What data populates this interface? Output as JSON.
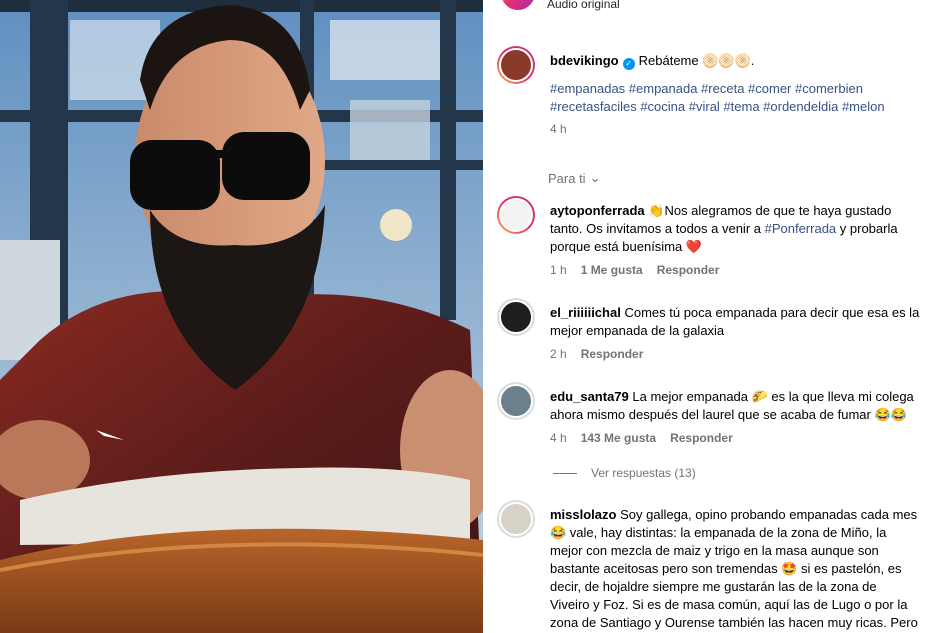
{
  "top": {
    "audio_label": "Audio original"
  },
  "post": {
    "username": "bdevikingo",
    "caption": "Rebáteme 🫓🫓🫓.",
    "hashtags_line1": "#empanadas #empanada #receta #comer #comerbien",
    "hashtags_line2": "#recetasfaciles #cocina #viral #tema #ordendeldia #melon",
    "time": "4 h"
  },
  "filter": {
    "label": "Para ti"
  },
  "comments": [
    {
      "username": "aytoponferrada",
      "text_a": "👏Nos alegramos de que te haya gustado",
      "text_b": "tanto. Os invitamos a todos a venir a ",
      "mention": "#Ponferrada",
      "text_c": " y probarla",
      "text_d": "porque está buenísima ❤️",
      "time": "1 h",
      "likes": "1 Me gusta",
      "reply": "Responder"
    },
    {
      "username": "el_riiiiiichal",
      "text_a": "Comes tú poca empanada para decir que esa es la",
      "text_b": "mejor empanada de la galaxia",
      "time": "2 h",
      "reply": "Responder"
    },
    {
      "username": "edu_santa79",
      "text_a": "La mejor empanada 🌮 es la que lleva mi colega",
      "text_b": "ahora mismo después del laurel que se acaba de fumar 😂😂",
      "time": "4 h",
      "likes": "143 Me gusta",
      "reply": "Responder"
    },
    {
      "username": "misslolazo",
      "text_a": "Soy gallega, opino probando empanadas cada mes",
      "text_b": "😂 vale, hay distintas: la empanada de la zona de Miño, la",
      "text_c": "mejor con mezcla de maiz y trigo en la masa aunque son",
      "text_d": "bastante aceitosas pero son tremendas 🤩 si es pastelón, es",
      "text_e": "decir, de hojaldre siempre me gustarán las de la zona de",
      "text_f": "Viveiro y Foz. Si es de masa común, aquí las de Lugo o por la",
      "text_g": "zona de Santiago y Ourense también las hacen muy ricas. Pero"
    }
  ],
  "view_replies": "Ver respuestas (13)"
}
